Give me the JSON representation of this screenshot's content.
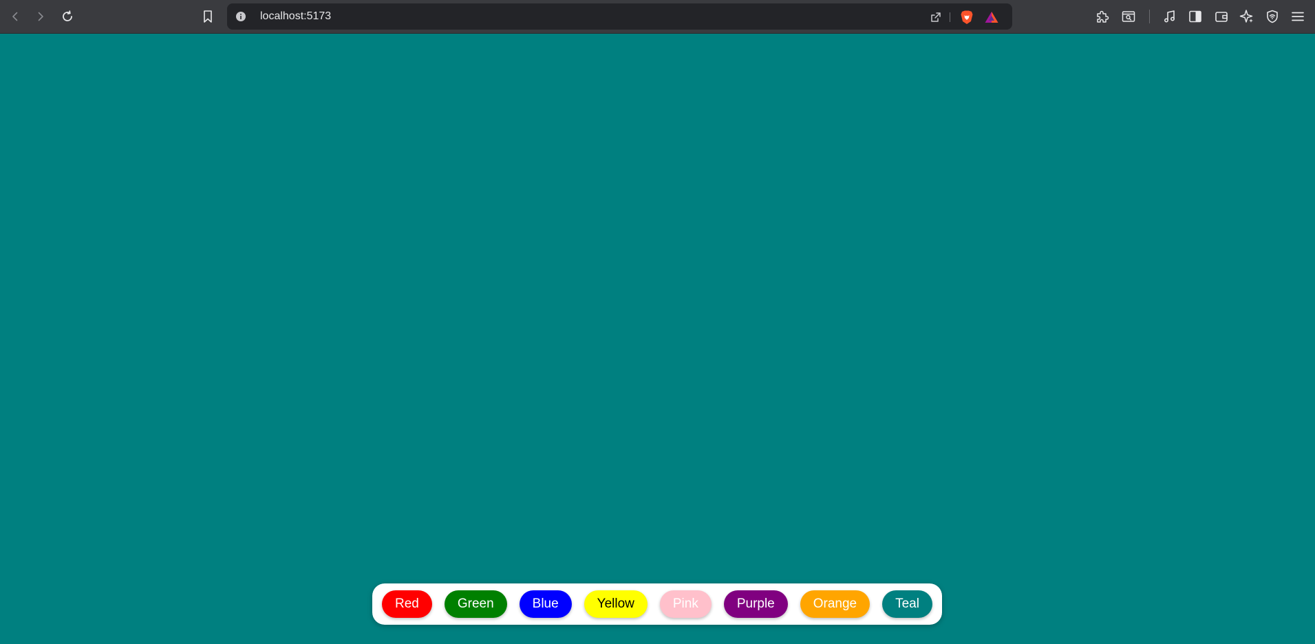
{
  "browser": {
    "url": "localhost:5173",
    "icons": {
      "back": "chevron-left-icon",
      "forward": "chevron-right-icon",
      "reload": "reload-icon",
      "bookmark": "bookmark-icon",
      "site_info": "info-icon",
      "share": "share-icon",
      "brave_shields": "brave-lion-icon",
      "brave_rewards": "brave-rewards-triangle-icon",
      "extensions": "puzzle-piece-icon",
      "tab_search": "tab-search-icon",
      "media": "music-note-icon",
      "sidebar": "sidebar-icon",
      "wallet": "wallet-icon",
      "leo_ai": "sparkle-icon",
      "vpn": "shield-icon",
      "menu": "hamburger-menu-icon"
    }
  },
  "page": {
    "background_color": "#008080",
    "buttons": [
      {
        "label": "Red",
        "color": "#ff0000",
        "text_color": "#ffffff"
      },
      {
        "label": "Green",
        "color": "#008000",
        "text_color": "#ffffff"
      },
      {
        "label": "Blue",
        "color": "#0000ff",
        "text_color": "#ffffff"
      },
      {
        "label": "Yellow",
        "color": "#ffff00",
        "text_color": "#000000"
      },
      {
        "label": "Pink",
        "color": "#ffc0cb",
        "text_color": "#ffffff"
      },
      {
        "label": "Purple",
        "color": "#800080",
        "text_color": "#ffffff"
      },
      {
        "label": "Orange",
        "color": "#ffa500",
        "text_color": "#ffffff"
      },
      {
        "label": "Teal",
        "color": "#008080",
        "text_color": "#ffffff"
      }
    ]
  }
}
